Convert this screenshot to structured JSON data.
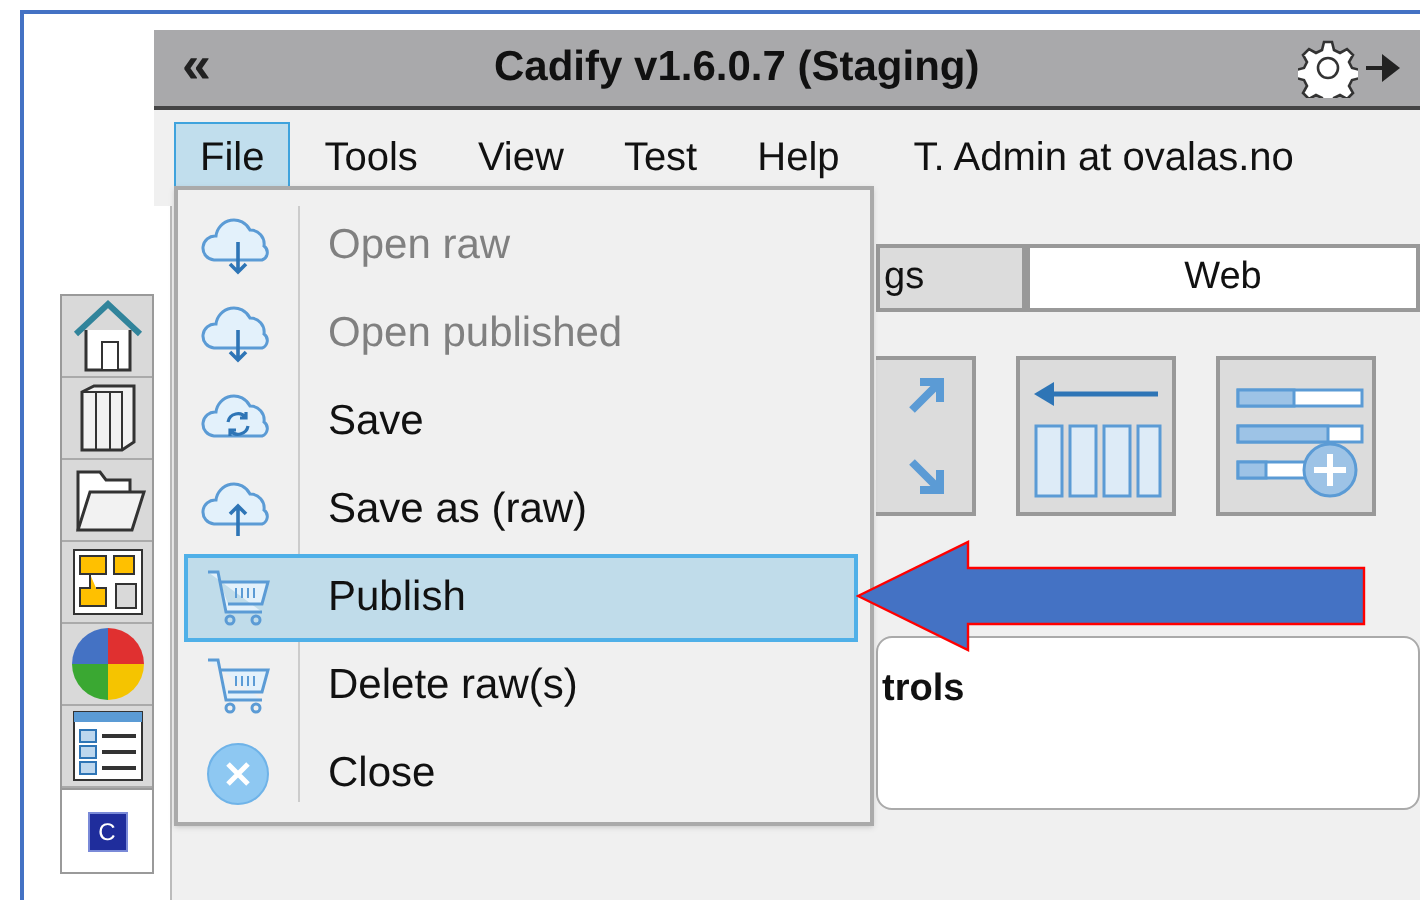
{
  "window": {
    "collapse_glyph": "«",
    "title": "Cadify v1.6.0.7 (Staging)"
  },
  "menu_bar": {
    "items": [
      {
        "label": "File",
        "selected": true
      },
      {
        "label": "Tools",
        "selected": false
      },
      {
        "label": "View",
        "selected": false
      },
      {
        "label": "Test",
        "selected": false
      },
      {
        "label": "Help",
        "selected": false
      }
    ],
    "user": "T. Admin at ovalas.no"
  },
  "side_toolbar": {
    "items": [
      {
        "kind": "home"
      },
      {
        "kind": "books"
      },
      {
        "kind": "folder"
      },
      {
        "kind": "layout"
      },
      {
        "kind": "ball"
      },
      {
        "kind": "list"
      }
    ],
    "badge": "C"
  },
  "tabs": [
    {
      "label": "gs",
      "selected": false
    },
    {
      "label": "Web",
      "selected": true
    }
  ],
  "tool_buttons": [
    {
      "kind": "arrows"
    },
    {
      "kind": "columns"
    },
    {
      "kind": "sliders"
    }
  ],
  "panel": {
    "heading": "trols"
  },
  "file_menu": {
    "items": [
      {
        "label": "Open raw",
        "kind": "download",
        "disabled": true,
        "selected": false
      },
      {
        "label": "Open published",
        "kind": "download",
        "disabled": true,
        "selected": false
      },
      {
        "label": "Save",
        "kind": "sync",
        "disabled": false,
        "selected": false
      },
      {
        "label": "Save as (raw)",
        "kind": "upload",
        "disabled": false,
        "selected": false
      },
      {
        "label": "Publish",
        "kind": "cart",
        "disabled": false,
        "selected": true
      },
      {
        "label": "Delete raw(s)",
        "kind": "cart",
        "disabled": false,
        "selected": false
      },
      {
        "label": "Close",
        "kind": "close",
        "disabled": false,
        "selected": false
      }
    ]
  }
}
